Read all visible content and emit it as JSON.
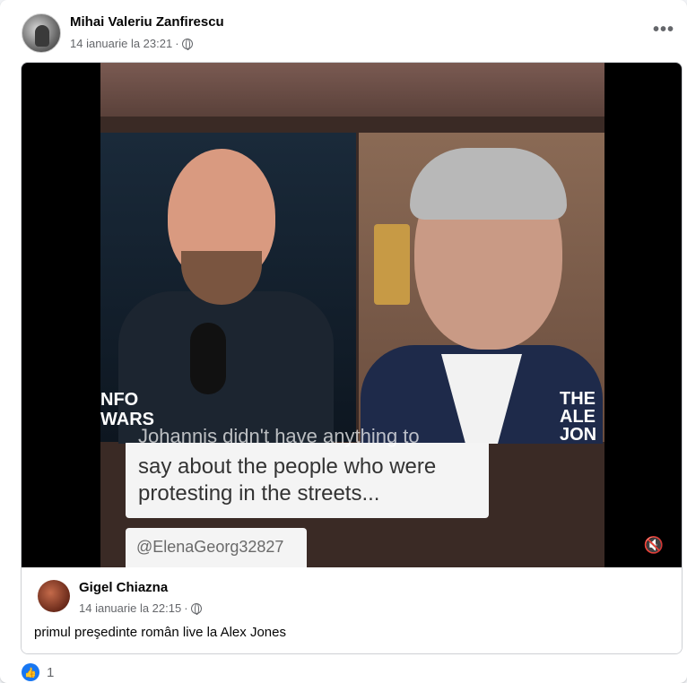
{
  "post": {
    "author": "Mihai Valeriu Zanfirescu",
    "timestamp": "14 ianuarie la 23:21",
    "separator": "·",
    "privacy_icon": "globe-icon",
    "more_icon": "•••"
  },
  "video": {
    "caption_line_ghost": "Johannis didn't have anything to",
    "caption_lines": [
      "say about the people who were",
      "protesting in the streets..."
    ],
    "handle": "@ElenaGeorg32827",
    "logo_left": "NFO\nWARS",
    "logo_right": "THE\nALE\nJON",
    "mute_icon": "🔇"
  },
  "comment": {
    "author": "Gigel Chiazna",
    "timestamp": "14 ianuarie la 22:15",
    "separator": "·",
    "text": "primul preşedinte român live la Alex Jones"
  },
  "reactions": {
    "like_icon": "👍",
    "count": "1"
  },
  "colors": {
    "accent": "#1877f2",
    "secondary_text": "#65676b",
    "primary_text": "#050505"
  }
}
